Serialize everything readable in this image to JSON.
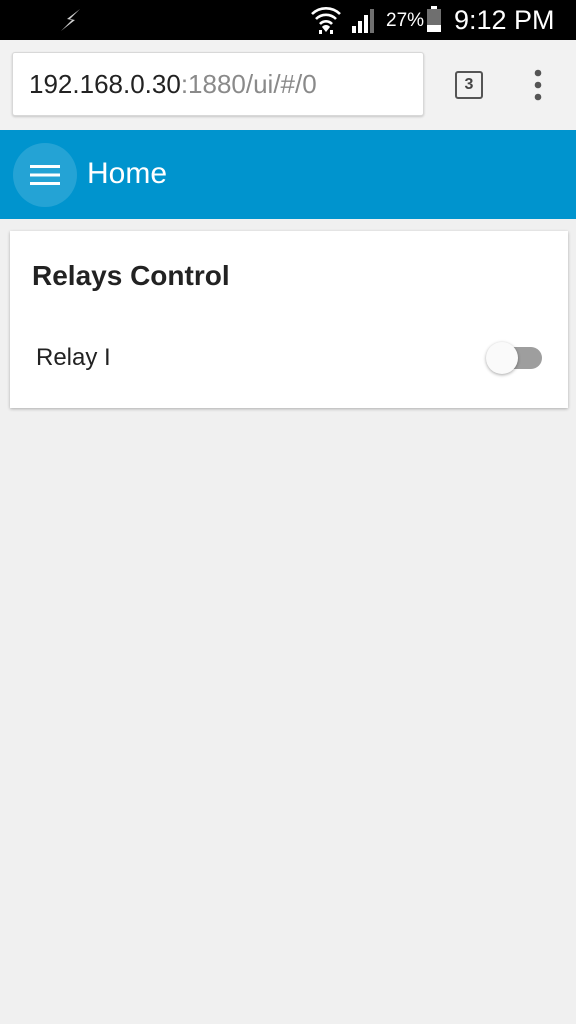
{
  "status_bar": {
    "battery_percent": "27%",
    "time": "9:12 PM",
    "icons": [
      "flash-icon",
      "wifi-icon",
      "signal-icon",
      "battery-icon"
    ]
  },
  "browser": {
    "url_host": "192.168.0.30",
    "url_rest": ":1880/ui/#/0",
    "tab_count": "3"
  },
  "header": {
    "title": "Home",
    "accent_color": "#0094ce"
  },
  "card": {
    "title": "Relays Control",
    "items": [
      {
        "label": "Relay I",
        "state": "off"
      }
    ]
  },
  "colors": {
    "background": "#f0f0f0",
    "status_bar": "#000000",
    "switch_track_off": "#9e9e9e"
  }
}
